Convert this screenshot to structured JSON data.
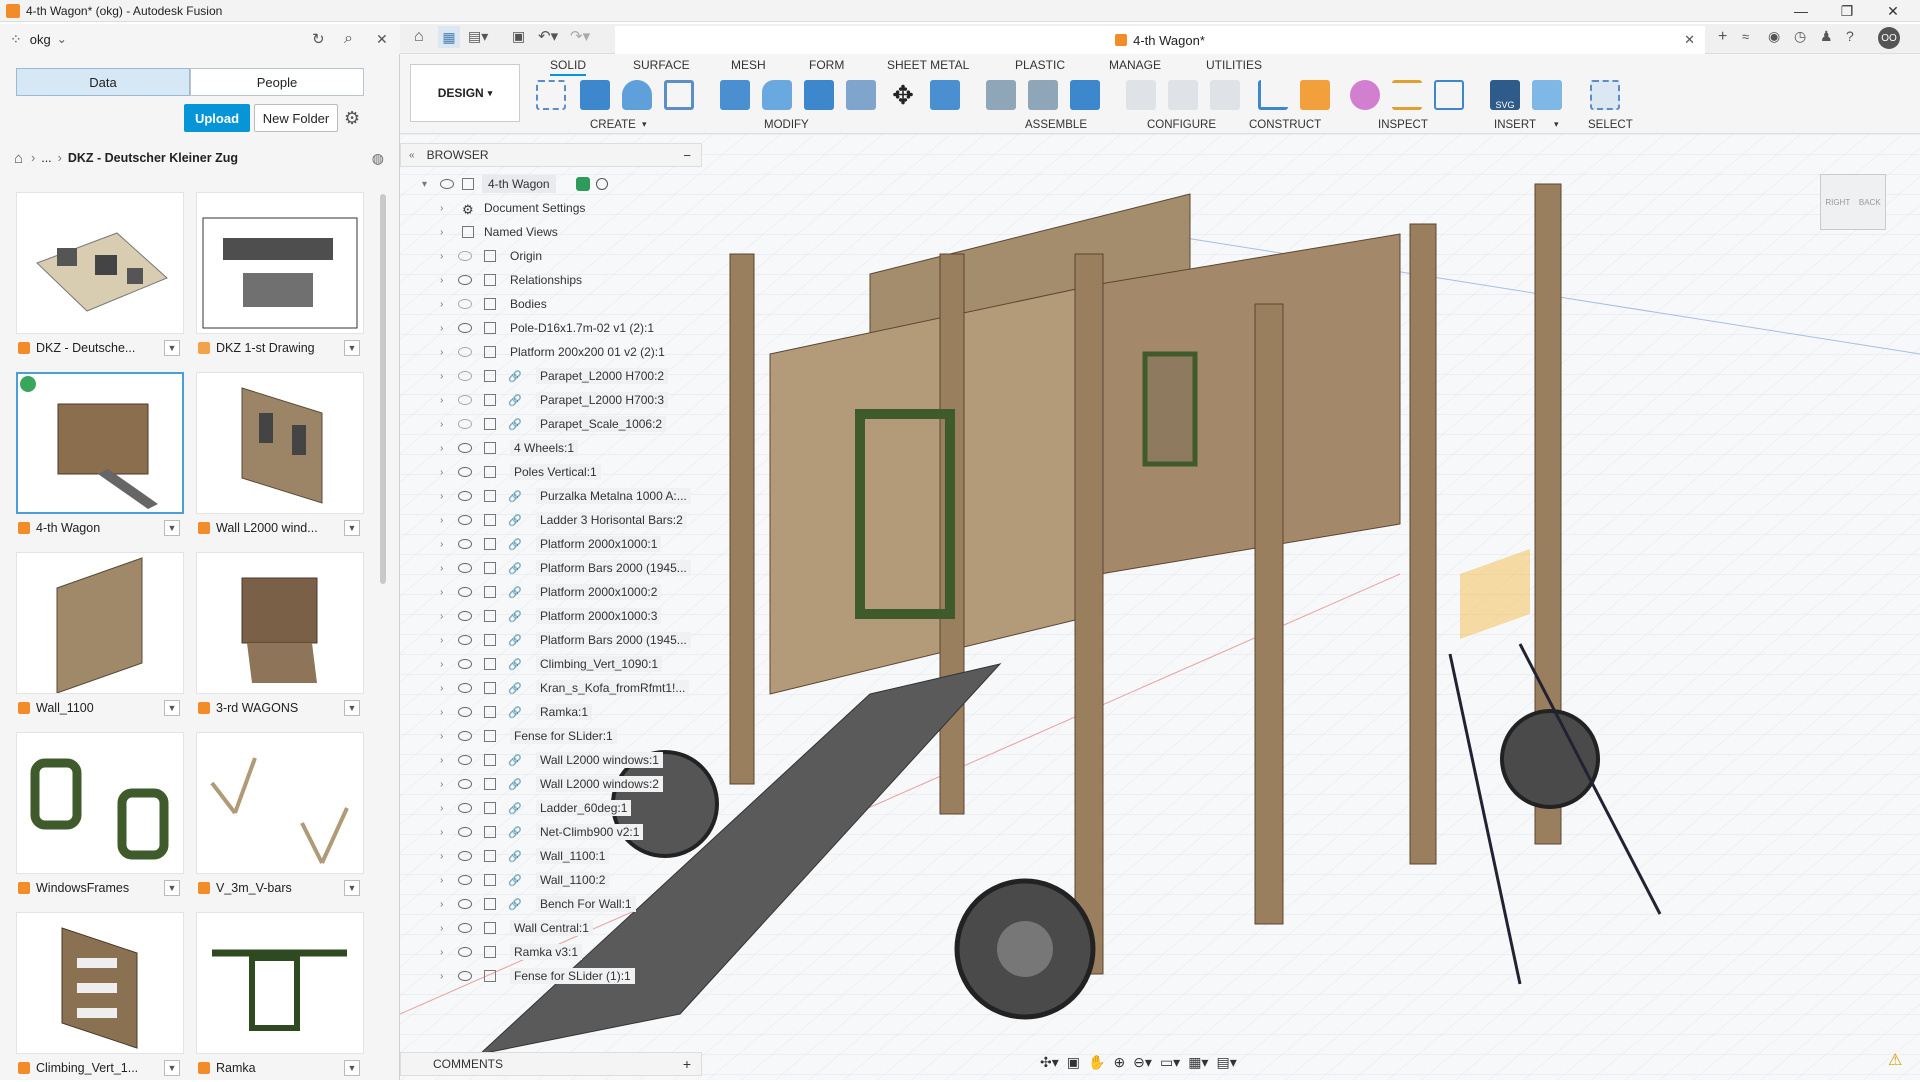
{
  "window": {
    "title": "4-th Wagon* (okg) - Autodesk Fusion",
    "min": "—",
    "max": "❐",
    "close": "✕"
  },
  "databar": {
    "team": "okg",
    "dropdown": "⌄",
    "refresh": "↻",
    "search": "⌕",
    "close": "✕"
  },
  "data_panel": {
    "tab_data": "Data",
    "tab_people": "People",
    "upload": "Upload",
    "new_folder": "New Folder",
    "breadcrumb": {
      "ellipsis": "...",
      "sep": "›",
      "current": "DKZ - Deutscher Kleiner Zug"
    },
    "items": [
      {
        "label": "DKZ - Deutsche..."
      },
      {
        "label": "DKZ 1-st Drawing"
      },
      {
        "label": "4-th Wagon"
      },
      {
        "label": "Wall L2000 wind..."
      },
      {
        "label": "Wall_1100"
      },
      {
        "label": "3-rd WAGONS"
      },
      {
        "label": "WindowsFrames"
      },
      {
        "label": "V_3m_V-bars"
      },
      {
        "label": "Climbing_Vert_1..."
      },
      {
        "label": "Ramka"
      }
    ]
  },
  "doc_tab": {
    "title": "4-th Wagon*"
  },
  "ribbon": {
    "workspace": "DESIGN",
    "tabs": [
      "SOLID",
      "SURFACE",
      "MESH",
      "FORM",
      "SHEET METAL",
      "PLASTIC",
      "MANAGE",
      "UTILITIES"
    ],
    "groups": [
      "CREATE",
      "MODIFY",
      "ASSEMBLE",
      "CONFIGURE",
      "CONSTRUCT",
      "INSPECT",
      "INSERT",
      "SELECT"
    ]
  },
  "browser": {
    "title": "BROWSER",
    "collapse": "−",
    "root": "4-th Wagon",
    "rows": [
      {
        "label": "Document Settings"
      },
      {
        "label": "Named Views"
      },
      {
        "label": "Origin"
      },
      {
        "label": "Relationships"
      },
      {
        "label": "Bodies"
      },
      {
        "label": "Pole-D16x1.7m-02 v1 (2):1"
      },
      {
        "label": "Platform 200x200 01 v2 (2):1"
      },
      {
        "label": "Parapet_L2000 H700:2"
      },
      {
        "label": "Parapet_L2000 H700:3"
      },
      {
        "label": "Parapet_Scale_1006:2"
      },
      {
        "label": "4 Wheels:1"
      },
      {
        "label": "Poles Vertical:1"
      },
      {
        "label": "Purzalka Metalna 1000 A:..."
      },
      {
        "label": "Ladder 3 Horisontal Bars:2"
      },
      {
        "label": "Platform 2000x1000:1"
      },
      {
        "label": "Platform Bars 2000 (1945..."
      },
      {
        "label": "Platform 2000x1000:2"
      },
      {
        "label": "Platform 2000x1000:3"
      },
      {
        "label": "Platform Bars 2000 (1945..."
      },
      {
        "label": "Climbing_Vert_1090:1"
      },
      {
        "label": "Kran_s_Kofa_fromRfmt1!..."
      },
      {
        "label": "Ramka:1"
      },
      {
        "label": "Fense for SLider:1"
      },
      {
        "label": "Wall L2000 windows:1"
      },
      {
        "label": "Wall L2000 windows:2"
      },
      {
        "label": "Ladder_60deg:1"
      },
      {
        "label": "Net-Climb900 v2:1"
      },
      {
        "label": "Wall_1100:1"
      },
      {
        "label": "Wall_1100:2"
      },
      {
        "label": "Bench For Wall:1"
      },
      {
        "label": "Wall Central:1"
      },
      {
        "label": "Ramka v3:1"
      },
      {
        "label": "Fense for SLider (1):1"
      }
    ]
  },
  "comments": {
    "title": "COMMENTS",
    "add": "+"
  },
  "viewcube": {
    "right": "RIGHT",
    "back": "BACK"
  }
}
